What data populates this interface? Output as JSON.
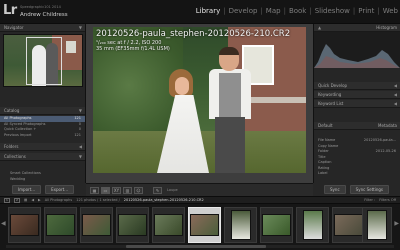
{
  "app": {
    "logo": "Lr",
    "identity_line1": "Speedgraphic101 2014",
    "identity_line2": "Andrew Childress"
  },
  "modules": [
    "Library",
    "Develop",
    "Map",
    "Book",
    "Slideshow",
    "Print",
    "Web"
  ],
  "active_module": "Library",
  "left_panel": {
    "navigator_title": "Navigator",
    "catalog_title": "Catalog",
    "catalog_items": [
      {
        "label": "All Photographs",
        "count": "121"
      },
      {
        "label": "All Synced Photographs",
        "count": "0"
      },
      {
        "label": "Quick Collection +",
        "count": "0"
      },
      {
        "label": "Previous Import",
        "count": "121"
      }
    ],
    "folders_title": "Folders",
    "collections_title": "Collections",
    "collection_items": [
      {
        "label": "Smart Collections",
        "count": ""
      },
      {
        "label": "Wedding",
        "count": ""
      }
    ],
    "publish_title": "Publish Services",
    "import_label": "Import...",
    "export_label": "Export..."
  },
  "right_panel": {
    "histogram_title": "Histogram",
    "quick_develop_title": "Quick Develop",
    "keywording_title": "Keywording",
    "keyword_list_title": "Keyword List",
    "metadata_title": "Metadata",
    "metadata_preset": "Default",
    "metadata_rows": [
      {
        "label": "File Name",
        "value": "20120526-paula..."
      },
      {
        "label": "Copy Name",
        "value": ""
      },
      {
        "label": "Folder",
        "value": "2012-05-26"
      },
      {
        "label": "Title",
        "value": ""
      },
      {
        "label": "Caption",
        "value": ""
      },
      {
        "label": "Rating",
        "value": ""
      },
      {
        "label": "Label",
        "value": ""
      }
    ],
    "sync_label": "Sync",
    "sync_settings_label": "Sync Settings"
  },
  "photo": {
    "file_name": "20120526-paula_stephen-20120526-210.CR2",
    "meta_line1": "¹/₂₀₀ sec at f / 2.2, ISO 200",
    "meta_line2": "35 mm (EF35mm f/1.4L USM)"
  },
  "toolbar": {
    "loupe_text": "Loupe"
  },
  "filmstrip": {
    "page1": "1",
    "page2": "2",
    "source": "All Photographs",
    "count_text": "121 photos / 1 selected /",
    "selected_file": "20120526-paula_stephen-20120526-210.CR2",
    "filter_label": "Filter :",
    "filter_value": "Filters Off"
  }
}
